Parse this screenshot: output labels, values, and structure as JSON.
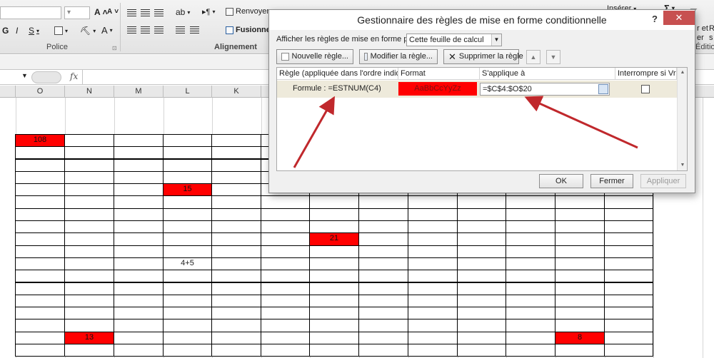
{
  "ribbon": {
    "clipboard_buttons": [
      "G",
      "I",
      "S"
    ],
    "increase_font": "A",
    "decrease_font": "A",
    "font_color": "A",
    "wrap_text": "Renvoyer",
    "merge": "Fusionner",
    "insert": "Insérer",
    "sigma": "Σ",
    "right_text_1": "r et",
    "right_text_2": "R",
    "right_text_3": "er",
    "right_text_4": "s",
    "editing_label": "Édition",
    "police_label": "Police",
    "alignment_label": "Alignement"
  },
  "formula_bar": {
    "fx": "fx"
  },
  "columns": [
    "O",
    "N",
    "M",
    "L",
    "K"
  ],
  "cells": [
    {
      "col": 0,
      "row": 3,
      "value": "108",
      "red": true
    },
    {
      "col": 3,
      "row": 7,
      "value": "15",
      "red": true
    },
    {
      "col": 6,
      "row": 11,
      "value": "21",
      "red": true
    },
    {
      "col": 3,
      "row": 13,
      "value": "4+5",
      "red": false
    },
    {
      "col": 1,
      "row": 19,
      "value": "13",
      "red": true
    },
    {
      "col": 11,
      "row": 19,
      "value": "8",
      "red": true
    }
  ],
  "dialog": {
    "title": "Gestionnaire des règles de mise en forme conditionnelle",
    "help": "?",
    "close": "✕",
    "show_rules_label": "Afficher les règles de mise en forme pour :",
    "show_rules_value": "Cette feuille de calcul",
    "new_rule": "Nouvelle règle...",
    "edit_rule": "Modifier la règle...",
    "delete_rule": "Supprimer la règle",
    "move_up": "▲",
    "move_down": "▼",
    "headers": {
      "rule": "Règle (appliquée dans l'ordre indiqué)",
      "format": "Format",
      "applies_to": "S'applique à",
      "stop_if_true": "Interrompre si Vrai"
    },
    "rule": {
      "formula": "Formule : =ESTNUM(C4)",
      "format_preview": "AaBbCcYyZz",
      "applies_to": "=$C$4:$O$20",
      "stop_if_true": false
    },
    "ok": "OK",
    "close_button": "Fermer",
    "apply": "Appliquer"
  },
  "colors": {
    "rule_highlight": "#eeeadb",
    "red_fill": "#ff0000",
    "arrow": "#c0282c",
    "close_button": "#c75050"
  }
}
